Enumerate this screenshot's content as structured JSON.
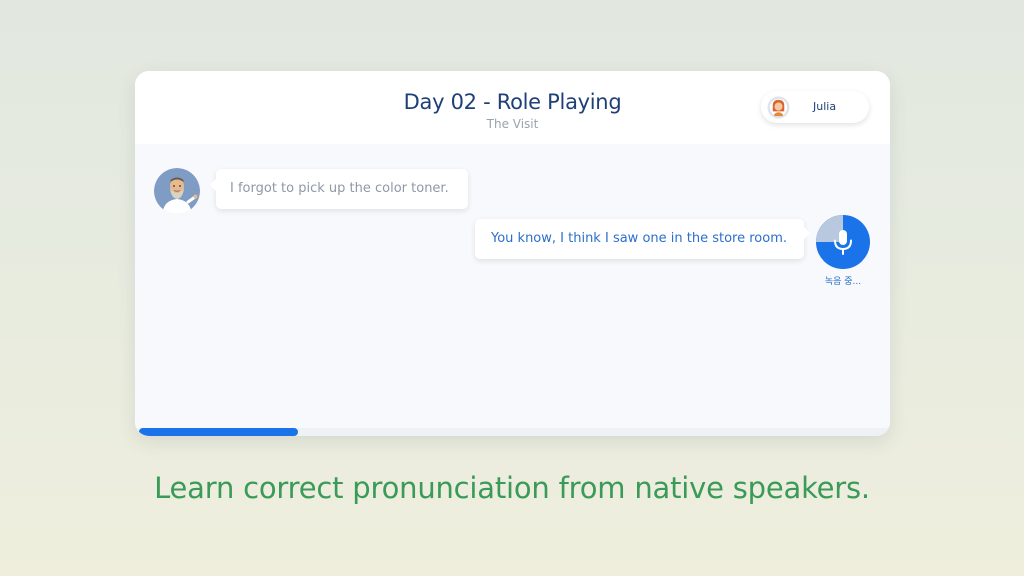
{
  "lesson": {
    "title": "Day 02 - Role Playing",
    "subtitle": "The Visit"
  },
  "user": {
    "name": "Julia",
    "avatar_icon": "user-avatar-icon"
  },
  "chat": {
    "messages": [
      {
        "role": "partner",
        "text": "I forgot to pick up the color toner.",
        "avatar_icon": "bot-avatar-icon"
      },
      {
        "role": "learner",
        "text": "You know, I think I saw one in the store room."
      }
    ],
    "mic": {
      "icon": "microphone-icon",
      "status_label": "녹음 중..."
    }
  },
  "progress": {
    "value": 0.21
  },
  "tagline": "Learn correct pronunciation from native speakers.",
  "colors": {
    "accent": "#1a73e8",
    "title": "#1f3f78",
    "tagline": "#3a9a58",
    "learner_text": "#2b6fce"
  }
}
